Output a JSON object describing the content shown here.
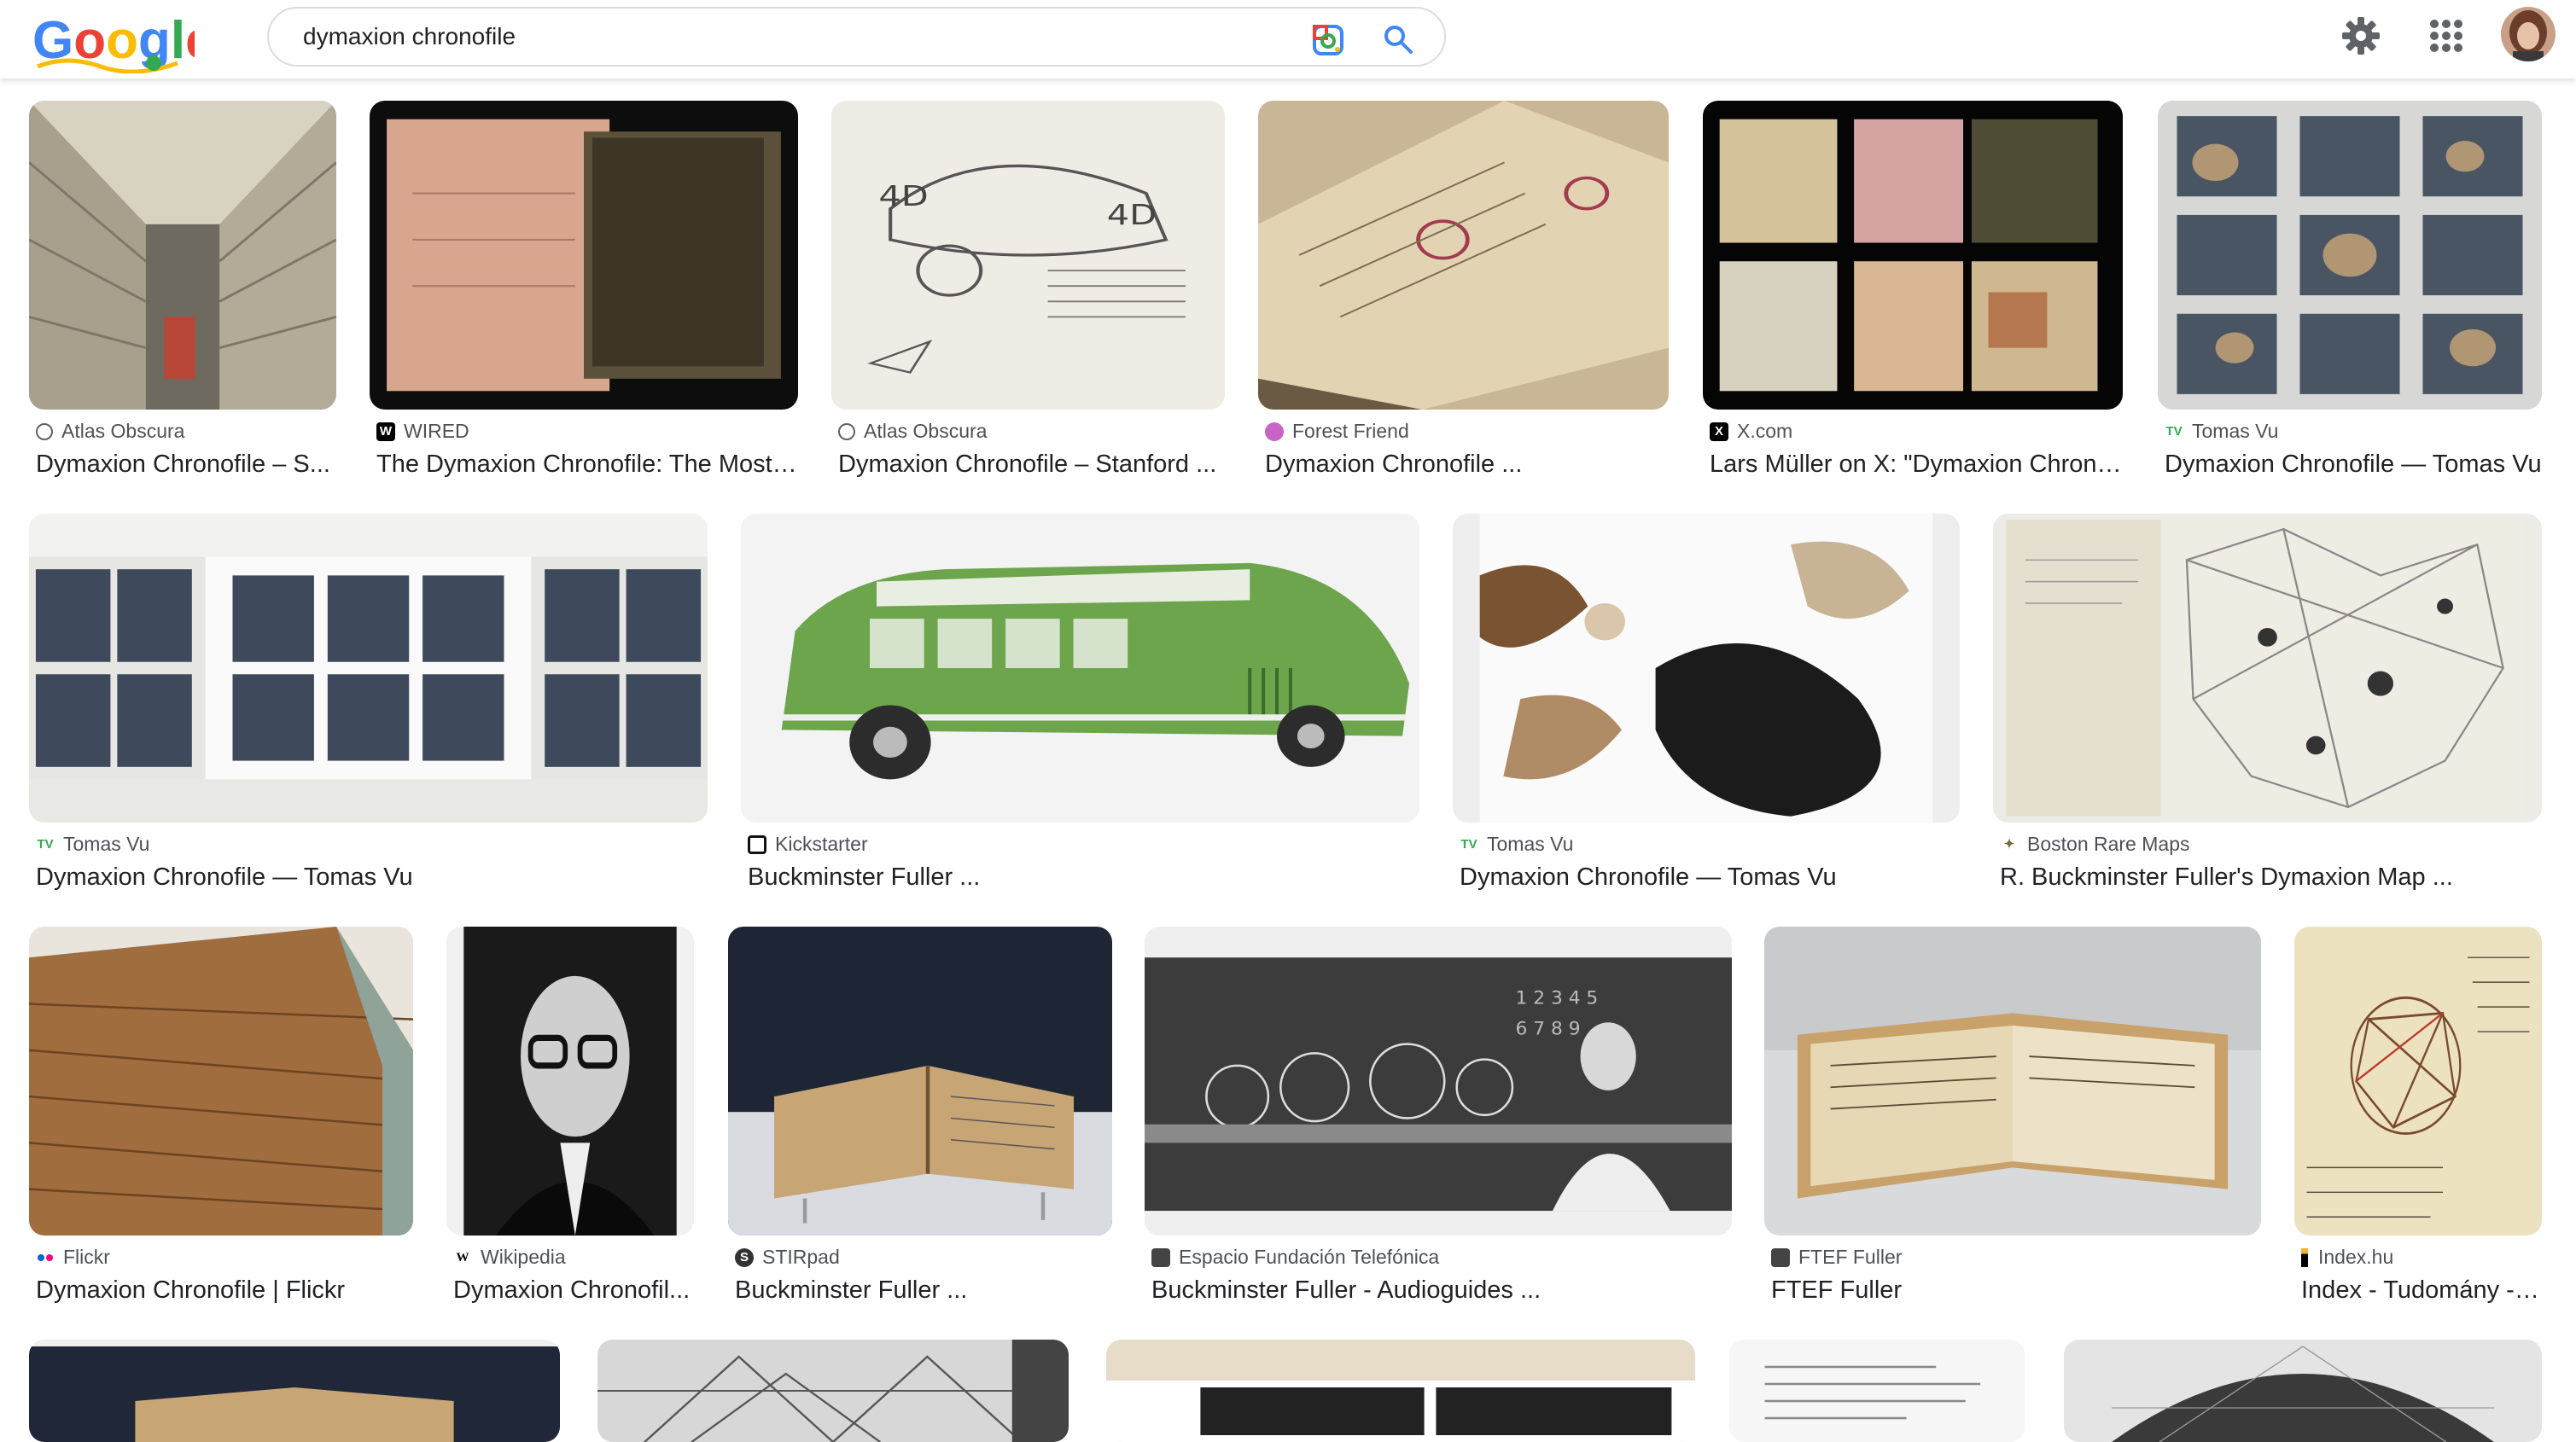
{
  "search": {
    "query": "dymaxion chronofile"
  },
  "results": [
    {
      "source": "Atlas Obscura",
      "title": "Dymaxion Chronofile – S...",
      "favicon": "atlas-obscura-favicon"
    },
    {
      "source": "WIRED",
      "title": "The Dymaxion Chronofile: The Most ...",
      "favicon": "wired-favicon"
    },
    {
      "source": "Atlas Obscura",
      "title": "Dymaxion Chronofile – Stanford ...",
      "favicon": "atlas-obscura-favicon"
    },
    {
      "source": "Forest Friend",
      "title": "Dymaxion Chronofile ...",
      "favicon": "forest-friend-favicon"
    },
    {
      "source": "X.com",
      "title": "Lars Müller on X: \"Dymaxion Chrono...",
      "favicon": "x-favicon"
    },
    {
      "source": "Tomas Vu",
      "title": "Dymaxion Chronofile — Tomas Vu",
      "favicon": "tomas-vu-favicon"
    },
    {
      "source": "Tomas Vu",
      "title": "Dymaxion Chronofile — Tomas Vu",
      "favicon": "tomas-vu-favicon"
    },
    {
      "source": "Kickstarter",
      "title": "Buckminster Fuller ...",
      "favicon": "kickstarter-favicon"
    },
    {
      "source": "Tomas Vu",
      "title": "Dymaxion Chronofile — Tomas Vu",
      "favicon": "tomas-vu-favicon"
    },
    {
      "source": "Boston Rare Maps",
      "title": "R. Buckminster Fuller's Dymaxion Map ...",
      "favicon": "boston-rare-maps-favicon"
    },
    {
      "source": "Flickr",
      "title": "Dymaxion Chronofile | Flickr",
      "favicon": "flickr-favicon"
    },
    {
      "source": "Wikipedia",
      "title": "Dymaxion Chronofil...",
      "favicon": "wikipedia-favicon"
    },
    {
      "source": "STIRpad",
      "title": "Buckminster Fuller ...",
      "favicon": "stirpad-favicon"
    },
    {
      "source": "Espacio Fundación Telefónica",
      "title": "Buckminster Fuller - Audioguides ...",
      "favicon": "espacio-favicon"
    },
    {
      "source": "FTEF Fuller",
      "title": "FTEF Fuller",
      "favicon": "ftef-favicon"
    },
    {
      "source": "Index.hu",
      "title": "Index - Tudomány - ...",
      "favicon": "index-favicon"
    }
  ],
  "colors": {
    "link_text": "#202124",
    "source_text": "#4d5156",
    "search_icon": "#4285f4"
  }
}
